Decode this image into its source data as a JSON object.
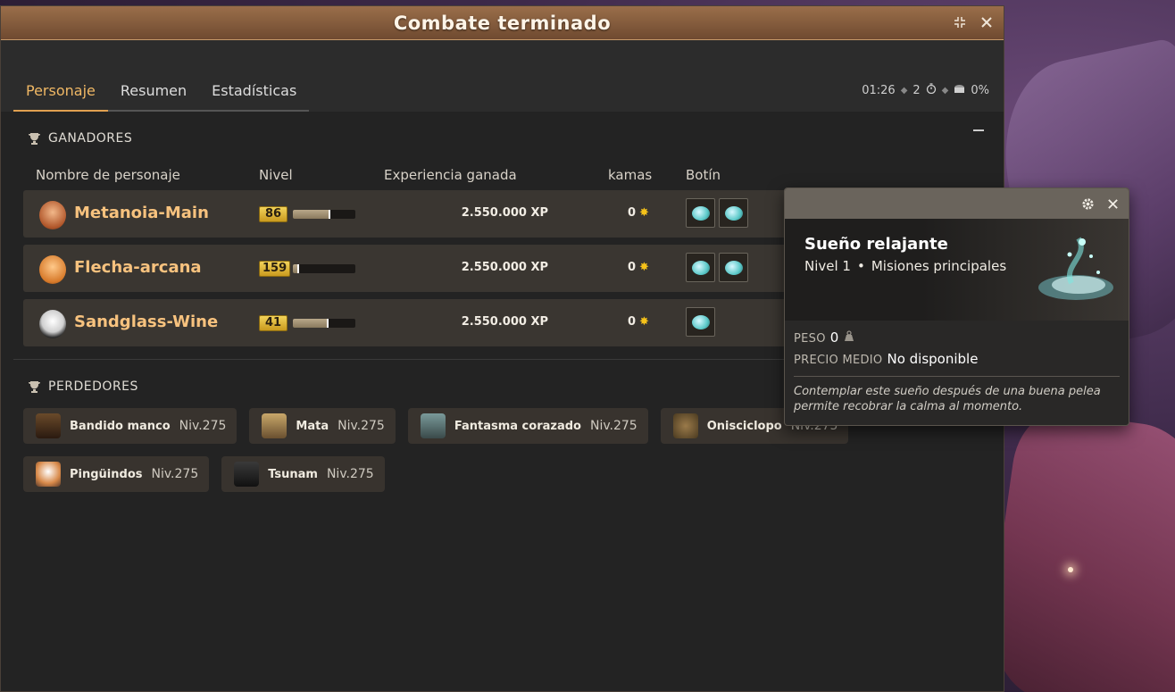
{
  "window": {
    "title": "Combate terminado"
  },
  "tabs": [
    {
      "label": "Personaje",
      "active": true
    },
    {
      "label": "Resumen",
      "active": false
    },
    {
      "label": "Estadísticas",
      "active": false
    }
  ],
  "stats": {
    "time": "01:26",
    "turns": "2",
    "percent": "0%"
  },
  "winners": {
    "title": "GANADORES",
    "columns": {
      "name": "Nombre de personaje",
      "level": "Nivel",
      "xp": "Experiencia ganada",
      "kamas": "kamas",
      "loot": "Botín"
    },
    "rows": [
      {
        "name": "Metanoia-Main",
        "level": "86",
        "xp_progress": 0.6,
        "xp": "2.550.000 XP",
        "kamas": "0",
        "loot": 2
      },
      {
        "name": "Flecha-arcana",
        "level": "159",
        "xp_progress": 0.1,
        "xp": "2.550.000 XP",
        "kamas": "0",
        "loot": 2
      },
      {
        "name": "Sandglass-Wine",
        "level": "41",
        "xp_progress": 0.57,
        "xp": "2.550.000 XP",
        "kamas": "0",
        "loot": 1
      }
    ]
  },
  "losers": {
    "title": "PERDEDORES",
    "items": [
      {
        "name": "Bandido manco",
        "level": "Niv.275"
      },
      {
        "name": "Mata",
        "level": "Niv.275"
      },
      {
        "name": "Fantasma corazado",
        "level": "Niv.275"
      },
      {
        "name": "Onisciclopo",
        "level": "Niv.275"
      },
      {
        "name": "Pingüindos",
        "level": "Niv.275"
      },
      {
        "name": "Tsunam",
        "level": "Niv.275"
      }
    ]
  },
  "tooltip": {
    "name": "Sueño relajante",
    "level": "Nivel 1",
    "category": "Misiones principales",
    "weight_label": "PESO",
    "weight": "0",
    "price_label": "PRECIO MEDIO",
    "price": "No disponible",
    "description": "Contemplar este sueño después de una buena pelea permite recobrar la calma al momento."
  }
}
